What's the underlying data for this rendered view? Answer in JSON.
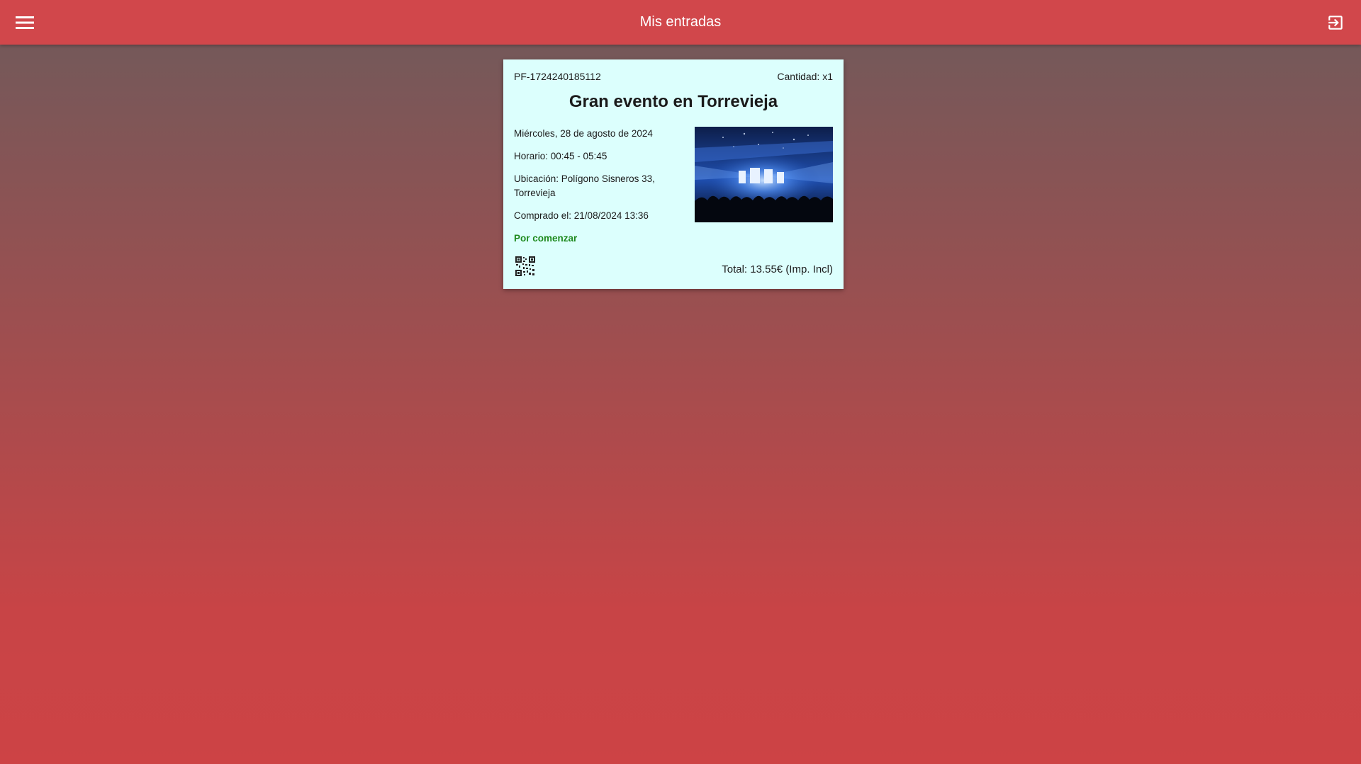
{
  "header": {
    "title": "Mis entradas",
    "menu_icon": "hamburger-menu-icon",
    "logout_icon": "logout-icon",
    "color": "#d1474b"
  },
  "ticket": {
    "code": "PF-1724240185112",
    "quantity": "Cantidad: x1",
    "event_title": "Gran evento en Torrevieja",
    "date": "Miércoles, 28 de agosto de 2024",
    "schedule": "Horario: 00:45 - 05:45",
    "location": "Ubicación: Polígono Sisneros 33, Torrevieja",
    "purchased": "Comprado el: 21/08/2024 13:36",
    "status": "Por comenzar",
    "status_color": "#1e8a1e",
    "total": "Total: 13.55€ (Imp. Incl)",
    "image_icon": "concert-image",
    "qr_icon": "qr-code-icon",
    "card_color": "#dcfffd"
  }
}
